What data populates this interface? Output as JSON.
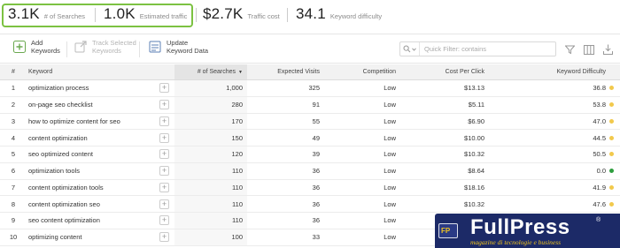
{
  "metrics": [
    {
      "value": "3.1K",
      "label": "# of Searches"
    },
    {
      "value": "1.0K",
      "label": "Estimated traffic"
    },
    {
      "value": "$2.7K",
      "label": "Traffic cost"
    },
    {
      "value": "34.1",
      "label": "Keyword difficulty"
    }
  ],
  "toolbar": {
    "add_keywords": {
      "line1": "Add",
      "line2": "Keywords"
    },
    "track_selected": {
      "line1": "Track Selected",
      "line2": "Keywords"
    },
    "update_data": {
      "line1": "Update",
      "line2": "Keyword Data"
    },
    "filter_placeholder": "Quick Filter: contains"
  },
  "table": {
    "headers": {
      "num": "#",
      "keyword": "Keyword",
      "searches": "# of Searches",
      "visits": "Expected Visits",
      "competition": "Competition",
      "cpc": "Cost Per Click",
      "difficulty": "Keyword Difficulty"
    },
    "rows": [
      {
        "num": "1",
        "keyword": "optimization process",
        "searches": "1,000",
        "visits": "325",
        "competition": "Low",
        "cpc": "$13.13",
        "difficulty": "36.8",
        "dot": "#f2c94c"
      },
      {
        "num": "2",
        "keyword": "on-page seo checklist",
        "searches": "280",
        "visits": "91",
        "competition": "Low",
        "cpc": "$5.11",
        "difficulty": "53.8",
        "dot": "#f2c94c"
      },
      {
        "num": "3",
        "keyword": "how to optimize content for seo",
        "searches": "170",
        "visits": "55",
        "competition": "Low",
        "cpc": "$6.90",
        "difficulty": "47.0",
        "dot": "#f2c94c"
      },
      {
        "num": "4",
        "keyword": "content optimization",
        "searches": "150",
        "visits": "49",
        "competition": "Low",
        "cpc": "$10.00",
        "difficulty": "44.5",
        "dot": "#f2c94c"
      },
      {
        "num": "5",
        "keyword": "seo optimized content",
        "searches": "120",
        "visits": "39",
        "competition": "Low",
        "cpc": "$10.32",
        "difficulty": "50.5",
        "dot": "#f2c94c"
      },
      {
        "num": "6",
        "keyword": "optimization tools",
        "searches": "110",
        "visits": "36",
        "competition": "Low",
        "cpc": "$8.64",
        "difficulty": "0.0",
        "dot": "#2e9e3e"
      },
      {
        "num": "7",
        "keyword": "content optimization tools",
        "searches": "110",
        "visits": "36",
        "competition": "Low",
        "cpc": "$18.16",
        "difficulty": "41.9",
        "dot": "#f2c94c"
      },
      {
        "num": "8",
        "keyword": "content optimization seo",
        "searches": "110",
        "visits": "36",
        "competition": "Low",
        "cpc": "$10.32",
        "difficulty": "47.6",
        "dot": "#f2c94c"
      },
      {
        "num": "9",
        "keyword": "seo content optimization",
        "searches": "110",
        "visits": "36",
        "competition": "Low",
        "cpc": "",
        "difficulty": "",
        "dot": ""
      },
      {
        "num": "10",
        "keyword": "optimizing content",
        "searches": "100",
        "visits": "33",
        "competition": "Low",
        "cpc": "",
        "difficulty": "",
        "dot": ""
      }
    ]
  },
  "watermark": {
    "badge": "FP",
    "logo": "FullPress",
    "reg": "®",
    "tagline": "magazine di tecnologie e business"
  },
  "colors": {
    "highlight": "#7cc242",
    "watermark_bg": "#1c2a67",
    "watermark_accent": "#f0c420"
  }
}
